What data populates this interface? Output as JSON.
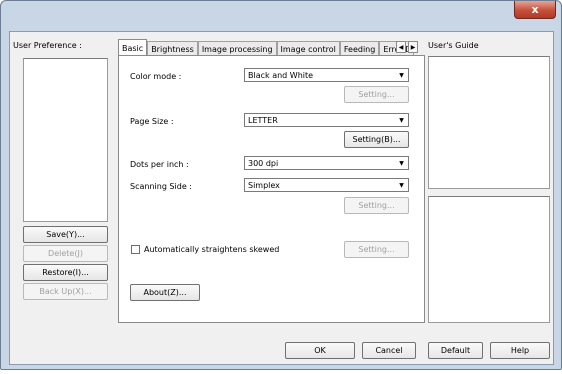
{
  "window": {
    "close_glyph": "x"
  },
  "user_preference": {
    "label": "User Preference :",
    "buttons": {
      "save": "Save(Y)...",
      "delete": "Delete(J)",
      "restore": "Restore(I)...",
      "backup": "Back Up(X)..."
    }
  },
  "tabs": [
    {
      "label": "Basic",
      "active": true
    },
    {
      "label": "Brightness",
      "active": false
    },
    {
      "label": "Image processing",
      "active": false
    },
    {
      "label": "Image control",
      "active": false
    },
    {
      "label": "Feeding",
      "active": false
    },
    {
      "label": "Error De",
      "active": false
    }
  ],
  "tab_scroll": {
    "left": "◀",
    "right": "▶"
  },
  "basic": {
    "color_mode": {
      "label": "Color mode :",
      "value": "Black and White",
      "setting": "Setting..."
    },
    "page_size": {
      "label": "Page Size :",
      "value": "LETTER",
      "setting": "Setting(B)..."
    },
    "dpi": {
      "label": "Dots per inch :",
      "value": "300 dpi"
    },
    "scanning_side": {
      "label": "Scanning Side :",
      "value": "Simplex",
      "setting": "Setting..."
    },
    "deskew": {
      "label": "Automatically straightens skewed",
      "checked": false,
      "setting": "Setting..."
    },
    "about": "About(Z)..."
  },
  "users_guide": {
    "label": "User's Guide"
  },
  "footer": {
    "ok": "OK",
    "cancel": "Cancel",
    "default": "Default",
    "help": "Help"
  },
  "combo_arrow": "▼"
}
